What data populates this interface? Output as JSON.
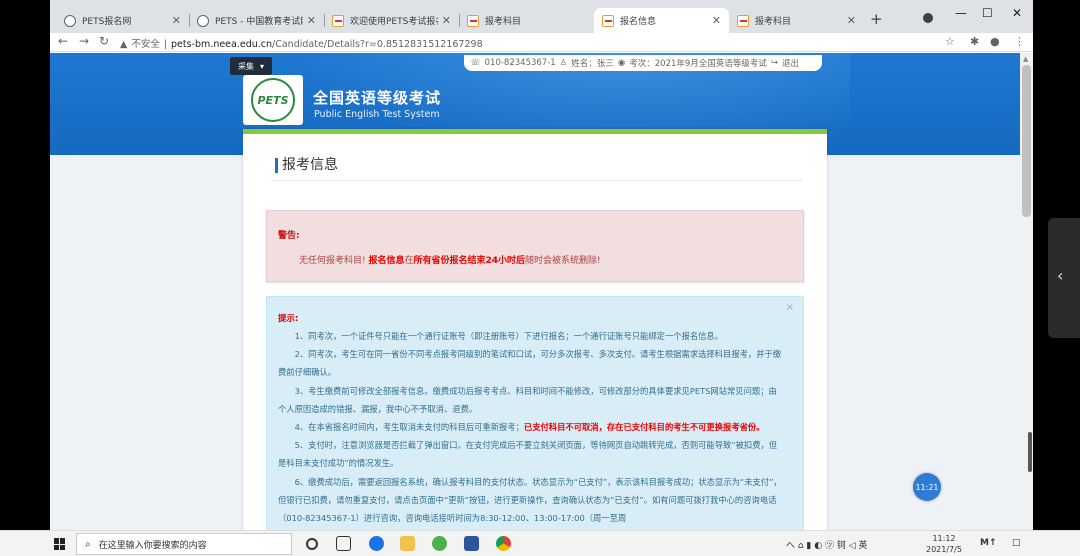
{
  "browser": {
    "tabs": [
      {
        "title": "PETS报名网",
        "fav": "globe",
        "active": false
      },
      {
        "title": "PETS - 中国教育考试网",
        "fav": "globe",
        "active": false
      },
      {
        "title": "欢迎使用PETS考试报名系统",
        "fav": "pets",
        "active": false
      },
      {
        "title": "报考科目",
        "fav": "pets",
        "active": false
      },
      {
        "title": "报名信息",
        "fav": "pets",
        "active": true
      },
      {
        "title": "报考科目",
        "fav": "pets",
        "active": false
      }
    ],
    "new_tab": "+",
    "url_warning": "不安全",
    "url_host": "pets-bm.neea.edu.cn",
    "url_path": "/Candidate/Details?r=0.8512831512167298"
  },
  "site": {
    "lang_button": "采集",
    "phone": "010-82345367-1",
    "name_label": "姓名：",
    "name_value": "张三",
    "exam_label": "考次：",
    "exam_value": "2021年9月全国英语等级考试",
    "logout": "退出",
    "logo_text": "PETS",
    "title": "全国英语等级考试",
    "subtitle": "Public English Test System"
  },
  "page": {
    "title": "报考信息"
  },
  "warning": {
    "heading": "警告:",
    "msg_pre": "无任何报考科目!",
    "msg_b1": "报名信息",
    "msg_mid": "在",
    "msg_b2": "所有省份报名结束24小时后",
    "msg_post": "随时会被系统删除!"
  },
  "tips": {
    "close": "×",
    "heading": "提示:",
    "p1": "1、同考次，一个证件号只能在一个通行证账号（即注册账号）下进行报名；一个通行证账号只能绑定一个报名信息。",
    "p2": "2、同考次，考生可在同一省份不同考点报考同级别的笔试和口试，可分多次报考、多次支付。请考生根据需求选择科目报考，并于缴费前仔细确认。",
    "p3": "3、考生缴费前可修改全部报考信息。缴费成功后报考考点、科目和时间不能修改，可修改部分的具体要求见PETS网站常见问题；由个人原因造成的错报、漏报，我中心不予取消、退费。",
    "p4_pre": "4、在本省报名时间内，考生取消未支付的科目后可重新报考；",
    "p4_bold": "已支付科目不可取消，存在已支付科目的考生不可更换报考省份。",
    "p5": "5、支付时，注意浏览器是否拦截了弹出窗口。在支付完成后不要立刻关闭页面，等待网页自动跳转完成，否则可能导致“被扣费，但是科目未支付成功”的情况发生。",
    "p6": "6、缴费成功后，需要返回报名系统，确认报考科目的支付状态。状态显示为“已支付”，表示该科目报考成功；状态显示为“未支付”，但银行已扣费，请勿重复支付，请点击页面中“更新”按钮，进行更新操作，查询确认状态为“已支付”。如有问题可拨打我中心的咨询电话（010-82345367-1）进行咨询，咨询电话接听时间为8:30-12:00、13:00-17:00（周一至周"
  },
  "float_button": "11:21",
  "taskbar": {
    "search_placeholder": "在这里输入你要搜索的内容",
    "tray_text": "へ ⌂ ▮ ◐ ㋡ 钶 ◁ 英",
    "time": "11:12",
    "date": "2021/7/5",
    "ime": "M↑",
    "notify": "□"
  }
}
